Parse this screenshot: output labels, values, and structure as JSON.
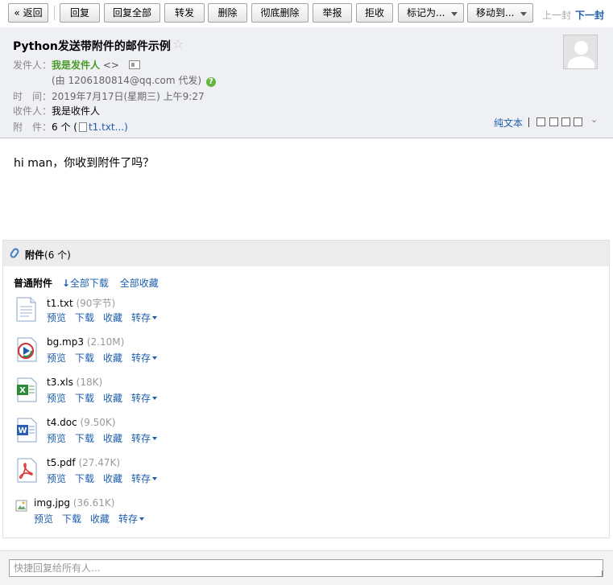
{
  "toolbar": {
    "back": "« 返回",
    "reply": "回复",
    "reply_all": "回复全部",
    "forward": "转发",
    "delete": "删除",
    "delete_forever": "彻底删除",
    "report": "举报",
    "reject": "拒收",
    "mark_as": "标记为...",
    "move_to": "移动到...",
    "prev": "上一封",
    "next": "下一封"
  },
  "header": {
    "subject": "Python发送带附件的邮件示例",
    "star": "☆",
    "from_label": "发件人：",
    "from_name": "我是发件人",
    "from_addr": "<>",
    "sent_by": "(由 1206180814@qq.com 代发)",
    "time_label": "时　间：",
    "time_value": "2019年7月17日(星期三) 上午9:27",
    "to_label": "收件人：",
    "to_value": "我是收件人",
    "att_label": "附　件：",
    "att_count": "6 个 (",
    "att_first": "t1.txt...",
    "att_close": ")",
    "plain_text": "纯文本",
    "chevron": "⌄"
  },
  "body": {
    "text": "hi man，你收到附件了吗？"
  },
  "attachments": {
    "title": "附件",
    "count": "(6 个)",
    "section_label": "普通附件",
    "download_all": "全部下载",
    "collect_all": "全部收藏",
    "actions": {
      "preview": "预览",
      "download": "下载",
      "collect": "收藏",
      "save_to": "转存"
    },
    "items": [
      {
        "name": "t1.txt",
        "size": "(90字节)",
        "icon": "txt-file-icon"
      },
      {
        "name": "bg.mp3",
        "size": "(2.10M)",
        "icon": "mp3-file-icon"
      },
      {
        "name": "t3.xls",
        "size": "(18K)",
        "icon": "excel-file-icon"
      },
      {
        "name": "t4.doc",
        "size": "(9.50K)",
        "icon": "word-file-icon"
      },
      {
        "name": "t5.pdf",
        "size": "(27.47K)",
        "icon": "pdf-file-icon"
      },
      {
        "name": "img.jpg",
        "size": "(36.61K)",
        "icon": "broken-image-icon"
      }
    ]
  },
  "quick_reply": {
    "placeholder": "快捷回复给所有人..."
  },
  "colors": {
    "link": "#1c5eab",
    "sender_green": "#4a9c2a",
    "header_bg": "#eef0f4",
    "attach_head_bg": "#ececec"
  }
}
